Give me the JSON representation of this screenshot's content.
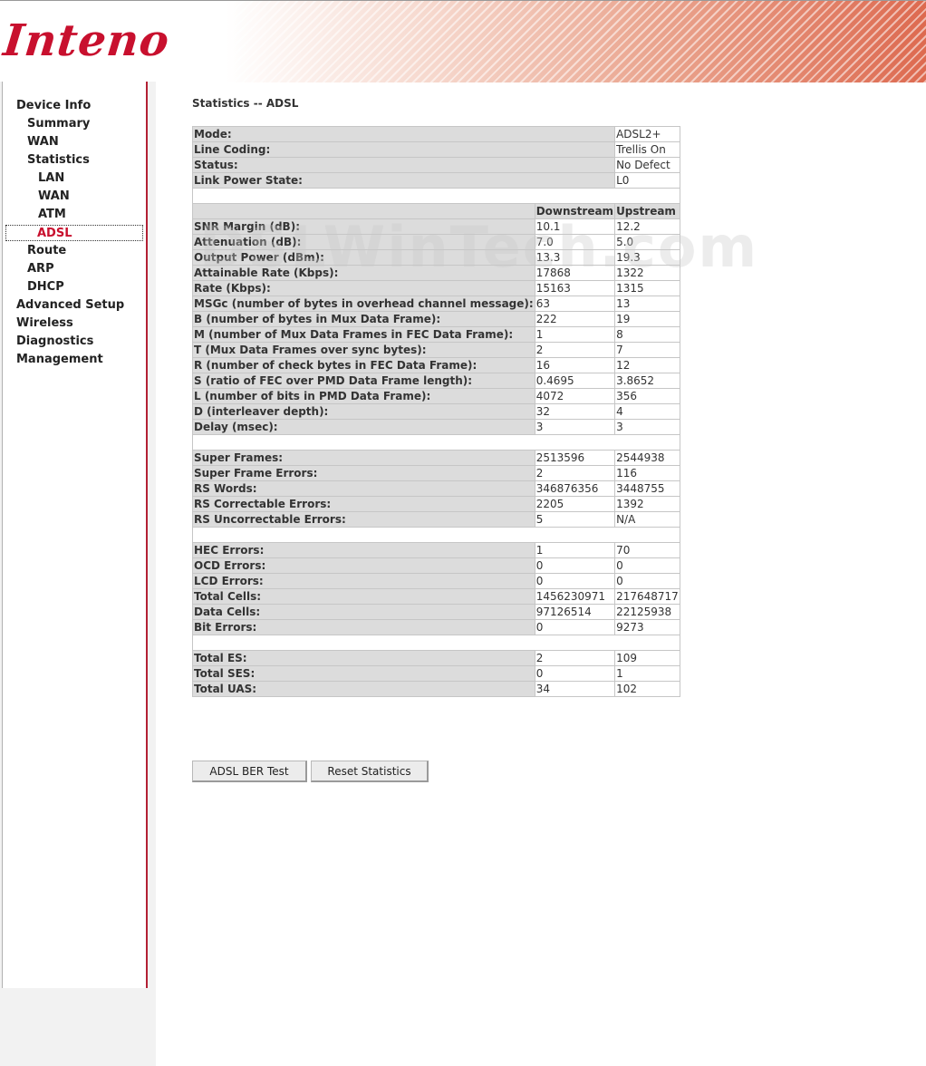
{
  "header": {
    "logo_text": "Inteno"
  },
  "sidebar": {
    "items": [
      {
        "label": "Device Info"
      },
      {
        "label": "Summary"
      },
      {
        "label": "WAN"
      },
      {
        "label": "Statistics"
      },
      {
        "label": "LAN"
      },
      {
        "label": "WAN"
      },
      {
        "label": "ATM"
      },
      {
        "label": "ADSL"
      },
      {
        "label": "Route"
      },
      {
        "label": "ARP"
      },
      {
        "label": "DHCP"
      },
      {
        "label": "Advanced Setup"
      },
      {
        "label": "Wireless"
      },
      {
        "label": "Diagnostics"
      },
      {
        "label": "Management"
      }
    ],
    "active": "ADSL"
  },
  "main": {
    "title": "Statistics -- ADSL",
    "watermark": "DSLWinTech.com",
    "mode_rows": [
      {
        "label": "Mode:",
        "value": "ADSL2+"
      },
      {
        "label": "Line Coding:",
        "value": "Trellis On"
      },
      {
        "label": "Status:",
        "value": "No Defect"
      },
      {
        "label": "Link Power State:",
        "value": "L0"
      }
    ],
    "columns": {
      "down": "Downstream",
      "up": "Upstream"
    },
    "groups": [
      [
        {
          "label": "SNR Margin (dB):",
          "down": "10.1",
          "up": "12.2"
        },
        {
          "label": "Attenuation (dB):",
          "down": "7.0",
          "up": "5.0"
        },
        {
          "label": "Output Power (dBm):",
          "down": "13.3",
          "up": "19.3"
        },
        {
          "label": "Attainable Rate (Kbps):",
          "down": "17868",
          "up": "1322"
        },
        {
          "label": "Rate (Kbps):",
          "down": "15163",
          "up": "1315"
        },
        {
          "label": "MSGc (number of bytes in overhead channel message):",
          "down": "63",
          "up": "13"
        },
        {
          "label": "B (number of bytes in Mux Data Frame):",
          "down": "222",
          "up": "19"
        },
        {
          "label": "M (number of Mux Data Frames in FEC Data Frame):",
          "down": "1",
          "up": "8"
        },
        {
          "label": "T (Mux Data Frames over sync bytes):",
          "down": "2",
          "up": "7"
        },
        {
          "label": "R (number of check bytes in FEC Data Frame):",
          "down": "16",
          "up": "12"
        },
        {
          "label": "S (ratio of FEC over PMD Data Frame length):",
          "down": "0.4695",
          "up": "3.8652"
        },
        {
          "label": "L (number of bits in PMD Data Frame):",
          "down": "4072",
          "up": "356"
        },
        {
          "label": "D (interleaver depth):",
          "down": "32",
          "up": "4"
        },
        {
          "label": "Delay (msec):",
          "down": "3",
          "up": "3"
        }
      ],
      [
        {
          "label": "Super Frames:",
          "down": "2513596",
          "up": "2544938"
        },
        {
          "label": "Super Frame Errors:",
          "down": "2",
          "up": "116"
        },
        {
          "label": "RS Words:",
          "down": "346876356",
          "up": "3448755"
        },
        {
          "label": "RS Correctable Errors:",
          "down": "2205",
          "up": "1392"
        },
        {
          "label": "RS Uncorrectable Errors:",
          "down": "5",
          "up": "N/A"
        }
      ],
      [
        {
          "label": "HEC Errors:",
          "down": "1",
          "up": "70"
        },
        {
          "label": "OCD Errors:",
          "down": "0",
          "up": "0"
        },
        {
          "label": "LCD Errors:",
          "down": "0",
          "up": "0"
        },
        {
          "label": "Total Cells:",
          "down": "1456230971",
          "up": "217648717"
        },
        {
          "label": "Data Cells:",
          "down": "97126514",
          "up": "22125938"
        },
        {
          "label": "Bit Errors:",
          "down": "0",
          "up": "9273"
        }
      ],
      [
        {
          "label": "Total ES:",
          "down": "2",
          "up": "109"
        },
        {
          "label": "Total SES:",
          "down": "0",
          "up": "1"
        },
        {
          "label": "Total UAS:",
          "down": "34",
          "up": "102"
        }
      ]
    ],
    "buttons": {
      "ber_test": "ADSL BER Test",
      "reset": "Reset Statistics"
    }
  },
  "colors": {
    "accent": "#c8102e",
    "sidebar_border": "#b32034",
    "label_bg": "#dcdcdc"
  }
}
